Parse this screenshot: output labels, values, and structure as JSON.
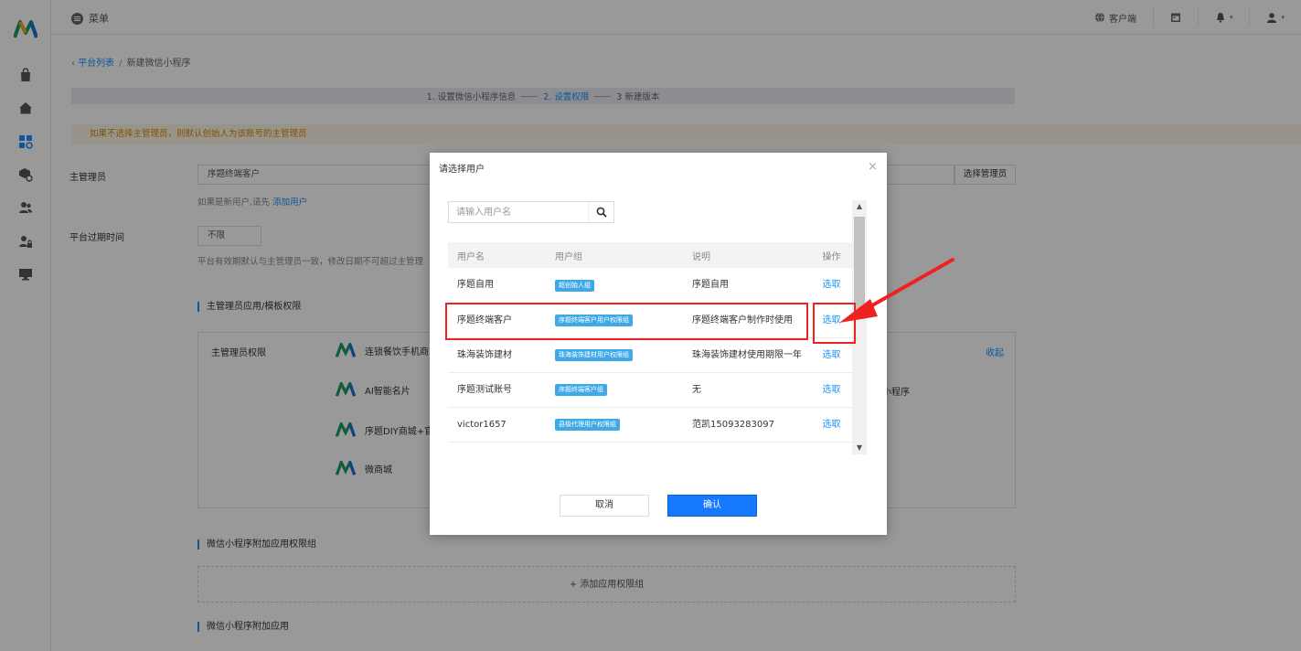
{
  "topbar": {
    "menu_label": "菜单",
    "client_label": "客户端"
  },
  "breadcrumb": {
    "back": "平台列表",
    "separator": "/",
    "current": "新建微信小程序"
  },
  "steps": {
    "step1": "1. 设置微信小程序信息",
    "step2": "2. 设置权限",
    "step3": "3 新建版本"
  },
  "warning": "如果不选择主管理员，则默认创始人为该账号的主管理员",
  "form": {
    "admin_label": "主管理员",
    "admin_value": "序题终端客户",
    "admin_button": "选择管理员",
    "admin_hint_prefix": "如果是新用户,请先",
    "admin_hint_link": "添加用户",
    "expire_label": "平台过期时间",
    "expire_value": "不限",
    "expire_hint": "平台有效期默认与主管理员一致，修改日期不可超过主管理"
  },
  "permissions": {
    "section_title": "主管理员应用/模板权限",
    "box_label": "主管理员权限",
    "collapse": "收起",
    "apps": [
      "连锁餐饮手机商",
      "AI智能名片",
      "序题DIY商城+官",
      "微商城"
    ],
    "extra_text": "小程序",
    "group_title": "微信小程序附加应用权限组",
    "add_group": "+ 添加应用权限组",
    "extra_app_title": "微信小程序附加应用"
  },
  "modal": {
    "title": "请选择用户",
    "close": "×",
    "search_placeholder": "请输入用户名",
    "columns": [
      "用户名",
      "用户组",
      "说明",
      "操作"
    ],
    "rows": [
      {
        "name": "序题自用",
        "group": "超创始人组",
        "desc": "序题自用",
        "action": "选取"
      },
      {
        "name": "序题终端客户",
        "group": "序题终端客户用户权限组",
        "desc": "序题终端客户制作时使用",
        "action": "选取"
      },
      {
        "name": "珠海装饰建材",
        "group": "珠海装饰建材用户权限组",
        "desc": "珠海装饰建材使用期限一年",
        "action": "选取"
      },
      {
        "name": "序题测试账号",
        "group": "序题终端客户组",
        "desc": "无",
        "action": "选取"
      },
      {
        "name": "victor1657",
        "group": "县级代理用户权限组",
        "desc": "范凯15093283097",
        "action": "选取"
      }
    ],
    "cancel": "取消",
    "confirm": "确认"
  },
  "colors": {
    "accent": "#1890ff",
    "tag": "#3fa9e8",
    "annotation": "#ee2222",
    "warning_text": "#d48806"
  }
}
